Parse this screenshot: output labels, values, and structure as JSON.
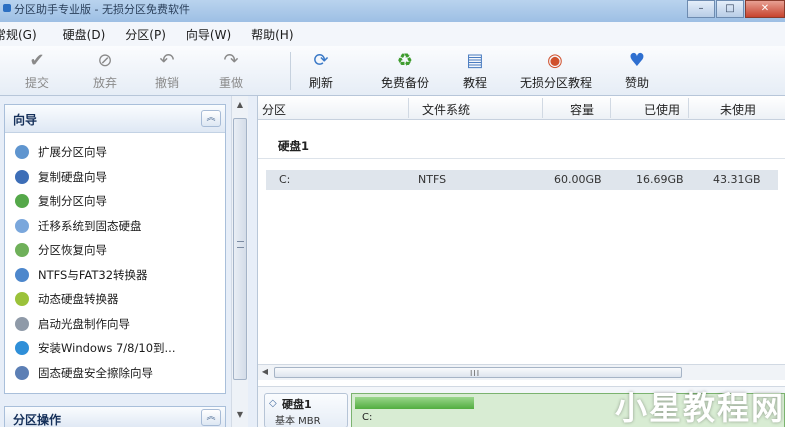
{
  "window": {
    "title": "分区助手专业版 - 无损分区免费软件",
    "minimize": "–",
    "maximize": "□",
    "close": "✕"
  },
  "menu": [
    "常规(G)",
    "硬盘(D)",
    "分区(P)",
    "向导(W)",
    "帮助(H)"
  ],
  "toolbar": {
    "commit": "提交",
    "discard": "放弃",
    "undo": "撤销",
    "redo": "重做",
    "refresh": "刷新",
    "backup": "免费备份",
    "tutorial": "教程",
    "lossless": "无损分区教程",
    "donate": "赞助"
  },
  "wizard": {
    "title": "向导",
    "collapse": "︽",
    "items": [
      "扩展分区向导",
      "复制硬盘向导",
      "复制分区向导",
      "迁移系统到固态硬盘",
      "分区恢复向导",
      "NTFS与FAT32转换器",
      "动态硬盘转换器",
      "启动光盘制作向导",
      "安装Windows 7/8/10到...",
      "固态硬盘安全擦除向导"
    ]
  },
  "partition_ops": {
    "title": "分区操作",
    "collapse": "︽"
  },
  "table": {
    "headers": [
      "分区",
      "文件系统",
      "容量",
      "已使用",
      "未使用"
    ],
    "disk_label": "硬盘1",
    "row": {
      "partition": "C:",
      "filesystem": "NTFS",
      "capacity": "60.00GB",
      "used": "16.69GB",
      "free": "43.31GB"
    }
  },
  "disk_map": {
    "name": "硬盘1",
    "type": "基本 MBR",
    "partition": "C:",
    "used_fraction": 0.28
  },
  "scroll": {
    "up": "▲",
    "down": "▼",
    "left": "◀",
    "grip": "III"
  },
  "watermark": "小星教程网",
  "colors": {
    "titlebar": "#aac8ea",
    "accent": "#2b6fc2",
    "partition_fill": "#52ad40"
  }
}
